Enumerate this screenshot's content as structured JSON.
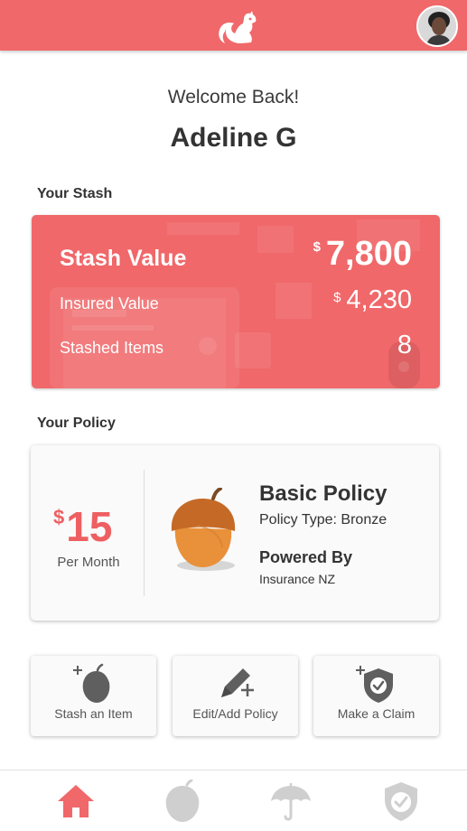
{
  "header": {
    "logo_icon": "squirrel-logo-icon",
    "avatar_icon": "user-avatar",
    "brand_color": "#f0686a"
  },
  "greeting": {
    "welcome": "Welcome Back!",
    "name": "Adeline G"
  },
  "stash": {
    "section_title": "Your Stash",
    "stash_value_label": "Stash Value",
    "stash_value_currency": "$",
    "stash_value": "7,800",
    "insured_value_label": "Insured Value",
    "insured_value_currency": "$",
    "insured_value": "4,230",
    "stashed_items_label": "Stashed Items",
    "stashed_items_count": "8"
  },
  "policy": {
    "section_title": "Your Policy",
    "price_currency": "$",
    "price": "15",
    "period": "Per Month",
    "icon": "acorn-icon",
    "name": "Basic Policy",
    "type": "Policy Type: Bronze",
    "powered_by_label": "Powered By",
    "powered_by": "Insurance NZ"
  },
  "actions": [
    {
      "label": "Stash an Item",
      "icon": "add-acorn-icon"
    },
    {
      "label": "Edit/Add Policy",
      "icon": "edit-pencil-icon"
    },
    {
      "label": "Make a Claim",
      "icon": "add-shield-icon"
    }
  ],
  "bottom_nav": [
    {
      "icon": "home-icon",
      "active": true
    },
    {
      "icon": "acorn-icon",
      "active": false
    },
    {
      "icon": "umbrella-icon",
      "active": false
    },
    {
      "icon": "shield-check-icon",
      "active": false
    }
  ],
  "colors": {
    "accent": "#f0686a",
    "price": "#ee5f62",
    "icon_gray": "#5f5f5f",
    "inactive_nav": "#cfcfcf"
  }
}
